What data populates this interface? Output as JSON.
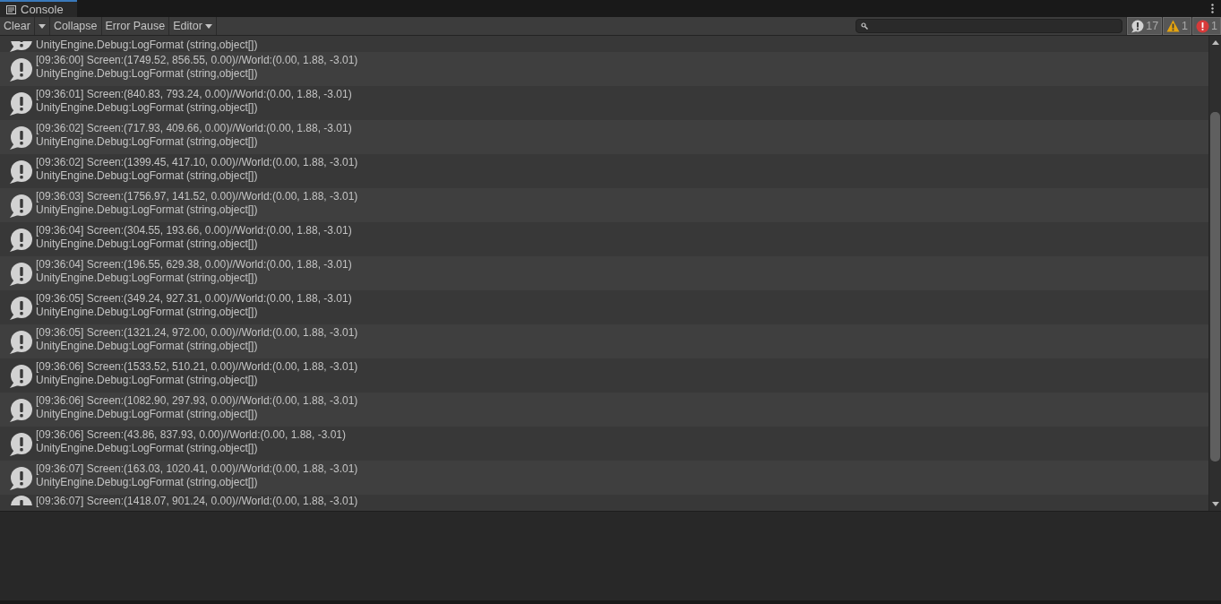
{
  "tab": {
    "title": "Console"
  },
  "toolbar": {
    "buttons": [
      {
        "kind": "split",
        "label": "Clear",
        "selected": false
      },
      {
        "kind": "toggle",
        "label": "Collapse",
        "selected": false
      },
      {
        "kind": "toggle",
        "label": "Error Pause",
        "selected": false
      },
      {
        "kind": "dropdown",
        "label": "Editor",
        "selected": false
      }
    ],
    "counters": [
      {
        "kind": "log",
        "count": "17",
        "selected": true
      },
      {
        "kind": "warning",
        "count": "1",
        "selected": true
      },
      {
        "kind": "error",
        "count": "1",
        "selected": true
      }
    ]
  },
  "log_rows": [
    {
      "stack": "UnityEngine.Debug:LogFormat (string,object[])"
    },
    {
      "message": "[09:36:00] Screen:(1749.52, 856.55, 0.00)//World:(0.00, 1.88, -3.01)",
      "stack": "UnityEngine.Debug:LogFormat (string,object[])"
    },
    {
      "message": "[09:36:01] Screen:(840.83, 793.24, 0.00)//World:(0.00, 1.88, -3.01)",
      "stack": "UnityEngine.Debug:LogFormat (string,object[])"
    },
    {
      "message": "[09:36:02] Screen:(717.93, 409.66, 0.00)//World:(0.00, 1.88, -3.01)",
      "stack": "UnityEngine.Debug:LogFormat (string,object[])"
    },
    {
      "message": "[09:36:02] Screen:(1399.45, 417.10, 0.00)//World:(0.00, 1.88, -3.01)",
      "stack": "UnityEngine.Debug:LogFormat (string,object[])"
    },
    {
      "message": "[09:36:03] Screen:(1756.97, 141.52, 0.00)//World:(0.00, 1.88, -3.01)",
      "stack": "UnityEngine.Debug:LogFormat (string,object[])"
    },
    {
      "message": "[09:36:04] Screen:(304.55, 193.66, 0.00)//World:(0.00, 1.88, -3.01)",
      "stack": "UnityEngine.Debug:LogFormat (string,object[])"
    },
    {
      "message": "[09:36:04] Screen:(196.55, 629.38, 0.00)//World:(0.00, 1.88, -3.01)",
      "stack": "UnityEngine.Debug:LogFormat (string,object[])"
    },
    {
      "message": "[09:36:05] Screen:(349.24, 927.31, 0.00)//World:(0.00, 1.88, -3.01)",
      "stack": "UnityEngine.Debug:LogFormat (string,object[])"
    },
    {
      "message": "[09:36:05] Screen:(1321.24, 972.00, 0.00)//World:(0.00, 1.88, -3.01)",
      "stack": "UnityEngine.Debug:LogFormat (string,object[])"
    },
    {
      "message": "[09:36:06] Screen:(1533.52, 510.21, 0.00)//World:(0.00, 1.88, -3.01)",
      "stack": "UnityEngine.Debug:LogFormat (string,object[])"
    },
    {
      "message": "[09:36:06] Screen:(1082.90, 297.93, 0.00)//World:(0.00, 1.88, -3.01)",
      "stack": "UnityEngine.Debug:LogFormat (string,object[])"
    },
    {
      "message": "[09:36:06] Screen:(43.86, 837.93, 0.00)//World:(0.00, 1.88, -3.01)",
      "stack": "UnityEngine.Debug:LogFormat (string,object[])"
    },
    {
      "message": "[09:36:07] Screen:(163.03, 1020.41, 0.00)//World:(0.00, 1.88, -3.01)",
      "stack": "UnityEngine.Debug:LogFormat (string,object[])"
    },
    {
      "message": "[09:36:07] Screen:(1418.07, 901.24, 0.00)//World:(0.00, 1.88, -3.01)"
    }
  ]
}
